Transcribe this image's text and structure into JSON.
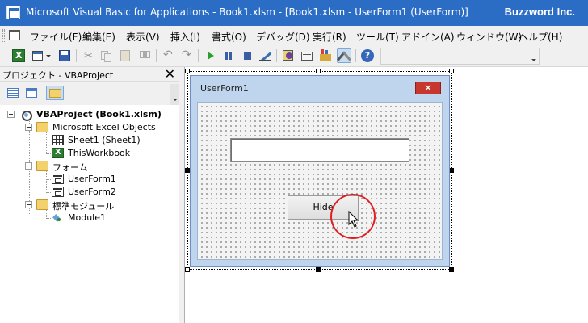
{
  "window": {
    "title": "Microsoft Visual Basic for Applications - Book1.xlsm - [Book1.xlsm - UserForm1 (UserForm)]",
    "brand": "Buzzword Inc."
  },
  "menu": {
    "items": [
      "ファイル(F)",
      "編集(E)",
      "表示(V)",
      "挿入(I)",
      "書式(O)",
      "デバッグ(D)",
      "実行(R)",
      "ツール(T)",
      "アドイン(A)",
      "ウィンドウ(W)",
      "ヘルプ(H)"
    ]
  },
  "toolbar": {
    "icons": [
      "excel-view-icon",
      "insert-userform-icon",
      "save-icon",
      "cut-icon",
      "copy-icon",
      "paste-icon",
      "find-icon",
      "undo-icon",
      "redo-icon",
      "run-icon",
      "break-icon",
      "reset-icon",
      "design-mode-icon",
      "project-explorer-icon",
      "properties-window-icon",
      "object-browser-icon",
      "toolbox-icon",
      "help-icon"
    ]
  },
  "project_explorer": {
    "title": "プロジェクト - VBAProject",
    "close_glyph": "✕",
    "tree": {
      "root": "VBAProject (Book1.xlsm)",
      "excel_objects": {
        "label": "Microsoft Excel Objects",
        "items": [
          "Sheet1 (Sheet1)",
          "ThisWorkbook"
        ]
      },
      "forms": {
        "label": "フォーム",
        "items": [
          "UserForm1",
          "UserForm2"
        ]
      },
      "modules": {
        "label": "標準モジュール",
        "items": [
          "Module1"
        ]
      }
    }
  },
  "designer": {
    "form_caption": "UserForm1",
    "close_glyph": "✕",
    "textbox_value": "",
    "button_label": "Hide"
  },
  "colors": {
    "titlebar": "#2b6cc4",
    "form_frame": "#bfd5ee",
    "highlight_ring": "#e02020"
  }
}
